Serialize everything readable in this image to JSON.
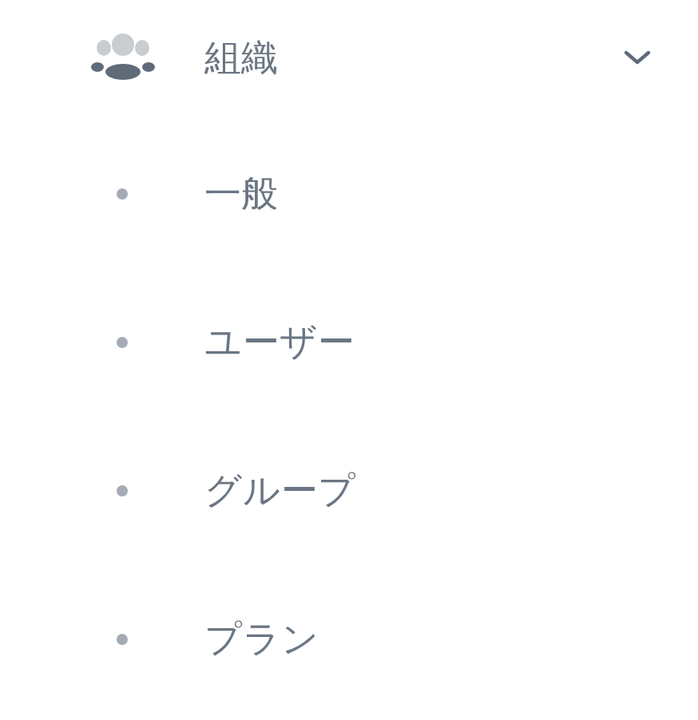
{
  "menu": {
    "label": "組織",
    "expanded": true,
    "children": [
      {
        "label": "一般"
      },
      {
        "label": "ユーザー"
      },
      {
        "label": "グループ"
      },
      {
        "label": "プラン"
      }
    ]
  }
}
